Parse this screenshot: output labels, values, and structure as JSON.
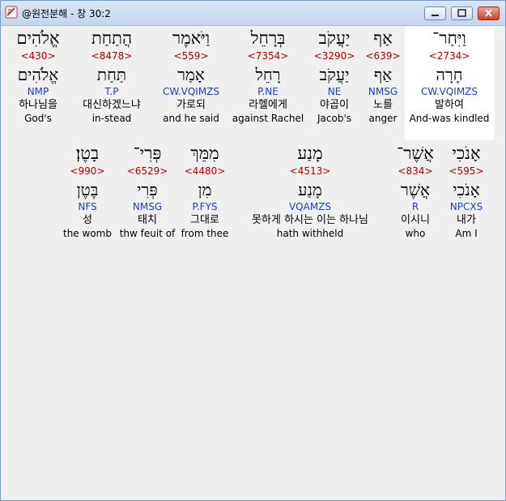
{
  "window": {
    "title": "@원전분해 - 창 30:2",
    "icon": "bible-tool-icon"
  },
  "row1": [
    {
      "heb": "וַיִּחַר־",
      "strong": "<2734>",
      "lex": "חָרָה",
      "parse": "CW.VQIMZS",
      "kor": "발하여",
      "eng": "And-was kindled",
      "highlight": true
    },
    {
      "heb": "אַף",
      "strong": "<639>",
      "lex": "אַף",
      "parse": "NMSG",
      "kor": "노를",
      "eng": "anger"
    },
    {
      "heb": "יַעֲקֹב",
      "strong": "<3290>",
      "lex": "יַעֲקֹב",
      "parse": "NE",
      "kor": "야곱이",
      "eng": "Jacob's"
    },
    {
      "heb": "בְּרָחֵל",
      "strong": "<7354>",
      "lex": "רָחֵל",
      "parse": "P.NE",
      "kor": "라헬에게",
      "eng": "against Rachel"
    },
    {
      "heb": "וַיֹּאמֶר",
      "strong": "<559>",
      "lex": "אָמַר",
      "parse": "CW.VQIMZS",
      "kor": "가로되",
      "eng": "and he said"
    },
    {
      "heb": "הֲתַחַת",
      "strong": "<8478>",
      "lex": "תַּחַת",
      "parse": "T.P",
      "kor": "대신하겠느냐",
      "eng": "in-stead"
    },
    {
      "heb": "אֱלֹהִים",
      "strong": "<430>",
      "lex": "אֱלֹהִים",
      "parse": "NMP",
      "kor": "하나님을",
      "eng": "God's"
    }
  ],
  "row2": [
    {
      "heb": "אָנֹכִי",
      "strong": "<595>",
      "lex": "אָנֹכִי",
      "parse": "NPCXS",
      "kor": "내가",
      "eng": "Am I"
    },
    {
      "heb": "אֲשֶׁר־",
      "strong": "<834>",
      "lex": "אֲשֶׁר",
      "parse": "R",
      "kor": "이시니",
      "eng": "who"
    },
    {
      "heb": "מָנַע",
      "strong": "<4513>",
      "lex": "מָנַע",
      "parse": "VQAMZS",
      "kor": "못하게 하시는 이는 하나님",
      "eng": "hath withheld"
    },
    {
      "heb": "מִמֵּךְ",
      "strong": "<4480>",
      "lex": "מִן",
      "parse": "P.FYS",
      "kor": "그대로",
      "eng": "from thee"
    },
    {
      "heb": "פְּרִי־",
      "strong": "<6529>",
      "lex": "פְּרִי",
      "parse": "NMSG",
      "kor": "태치",
      "eng": "thw feuit of"
    },
    {
      "heb": "בָטֶן׃",
      "strong": "<990>",
      "lex": "בֶּטֶן",
      "parse": "NFS",
      "kor": "성",
      "eng": "the womb"
    }
  ]
}
